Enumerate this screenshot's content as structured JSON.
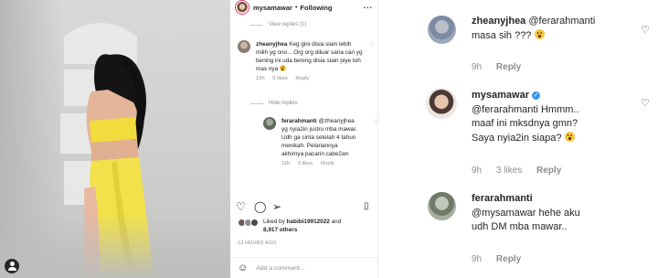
{
  "post": {
    "username": "mysamawar",
    "following_label": "Following",
    "more_label": "...",
    "view_replies": "View replies (1)",
    "hide_replies": "Hide replies",
    "comments": [
      {
        "username": "zheanyjhea",
        "text": "Keg gini disia siain lebih milih yg ono... Org org diluar sana cari yg bening ini uda bening disia siain piye toh mas nya",
        "age": "12h",
        "likes": "5 likes",
        "reply": "Reply"
      },
      {
        "username": "ferarahmanti",
        "text": "@zheanyjhea yg nyia2in justru mba mawar. Udh ga cinta setelah 4 tahun menikah. Pelariannya akhirnya pacarin cabe2an",
        "age": "11h",
        "likes": "3 likes",
        "reply": "Reply"
      }
    ],
    "liked_by_prefix": "Liked by ",
    "liked_by_user": "habibi19912022",
    "liked_by_and": " and",
    "liked_by_others": "8,917 others",
    "timestamp": "13 HOURS AGO",
    "add_comment_placeholder": "Add a comment..."
  },
  "zoom": {
    "comments": [
      {
        "username": "zheanyjhea",
        "mention": "@ferarahmanti",
        "text": "masa sih ???",
        "age": "9h",
        "reply": "Reply"
      },
      {
        "username": "mysamawar",
        "mention": "@ferarahmanti",
        "text_line1": "Hmmm..",
        "text_line2": "maaf ini mksdnya gmn?",
        "text_line3": "Saya nyia2in siapa?",
        "age": "9h",
        "likes": "3 likes",
        "reply": "Reply"
      },
      {
        "username": "ferarahmanti",
        "mention": "@mysamawar",
        "text_line1": "hehe aku",
        "text_line2": "udh DM mba mawar..",
        "age": "9h",
        "reply": "Reply"
      }
    ]
  },
  "icons": {
    "heart": "heart-outline-icon",
    "comment": "comment-icon",
    "share": "paper-plane-icon",
    "save": "bookmark-icon",
    "emoji": "emoji-icon",
    "verified": "verified-badge-icon",
    "profile": "profile-icon"
  },
  "colors": {
    "verified": "#3897f0",
    "muted": "#8e8e8e",
    "dress": "#f1e04a"
  }
}
